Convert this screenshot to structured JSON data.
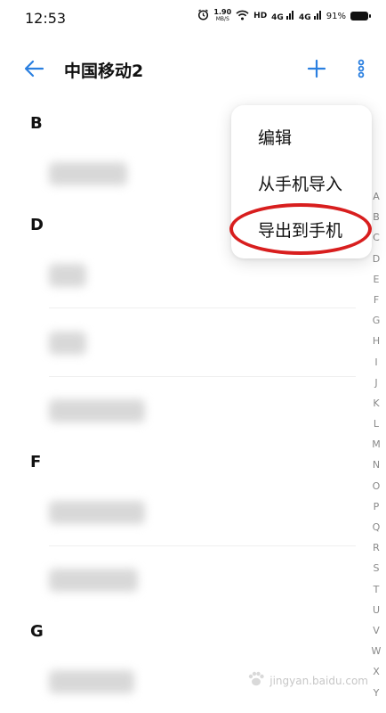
{
  "status_bar": {
    "time": "12:53",
    "net_speed": "1.90",
    "net_unit": "MB/S",
    "hd_label": "HD",
    "signal1": "4G",
    "signal2": "4G",
    "battery": "91%"
  },
  "header": {
    "title": "中国移动2",
    "back_icon": "arrow-left",
    "add_icon": "plus",
    "more_icon": "vertical-dots",
    "accent_color": "#2a7fe0"
  },
  "sections": [
    {
      "letter": "B"
    },
    {
      "letter": "D"
    },
    {
      "letter": "F"
    },
    {
      "letter": "G"
    }
  ],
  "menu": {
    "items": [
      "编辑",
      "从手机导入",
      "导出到手机"
    ],
    "highlight_color": "#d81e1e"
  },
  "alpha_index": [
    "A",
    "B",
    "C",
    "D",
    "E",
    "F",
    "G",
    "H",
    "I",
    "J",
    "K",
    "L",
    "M",
    "N",
    "O",
    "P",
    "Q",
    "R",
    "S",
    "T",
    "U",
    "V",
    "W",
    "X",
    "Y"
  ],
  "watermark": {
    "text": "jingyan.baidu.com"
  }
}
